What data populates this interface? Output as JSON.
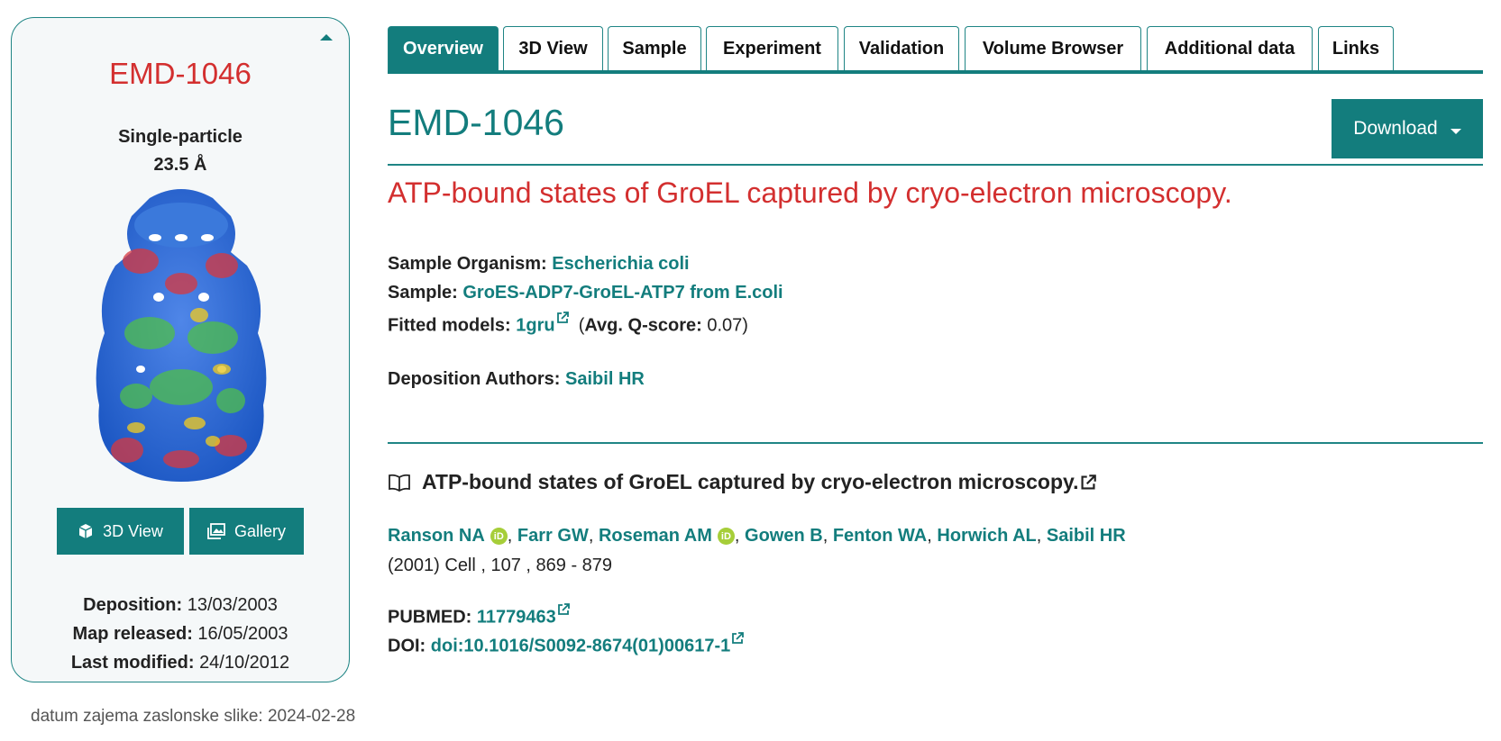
{
  "card": {
    "entry_id": "EMD-1046",
    "method": "Single-particle",
    "resolution": "23.5 Å",
    "buttons": {
      "view3d": "3D View",
      "gallery": "Gallery"
    },
    "deposition_label": "Deposition:",
    "deposition_value": "13/03/2003",
    "released_label": "Map released:",
    "released_value": "16/05/2003",
    "modified_label": "Last modified:",
    "modified_value": "24/10/2012"
  },
  "tabs": [
    {
      "label": "Overview",
      "active": true
    },
    {
      "label": "3D View"
    },
    {
      "label": "Sample"
    },
    {
      "label": "Experiment"
    },
    {
      "label": "Validation"
    },
    {
      "label": "Volume Browser"
    },
    {
      "label": "Additional data"
    },
    {
      "label": "Links"
    }
  ],
  "header": {
    "entry_id": "EMD-1046",
    "download_label": "Download"
  },
  "entry_title": "ATP-bound states of GroEL captured by cryo-electron microscopy.",
  "info": {
    "organism_label": "Sample Organism:",
    "organism_value": "Escherichia coli",
    "sample_label": "Sample:",
    "sample_value": "GroES-ADP7-GroEL-ATP7 from E.coli",
    "fitted_label": "Fitted models:",
    "fitted_value": "1gru",
    "qscore_label": "Avg. Q-score:",
    "qscore_value": "0.07",
    "authors_label": "Deposition Authors:",
    "authors_value": "Saibil HR"
  },
  "publication": {
    "title": "ATP-bound states of GroEL captured by cryo-electron microscopy.",
    "authors": [
      "Ranson NA",
      "Farr GW",
      "Roseman AM",
      "Gowen B",
      "Fenton WA",
      "Horwich AL",
      "Saibil HR"
    ],
    "citation": "(2001) Cell , 107 , 869 - 879",
    "pubmed_label": "PUBMED:",
    "pubmed_value": "11779463",
    "doi_label": "DOI:",
    "doi_value": "doi:10.1016/S0092-8674(01)00617-1"
  },
  "footer_note": "datum zajema zaslonske slike: 2024-02-28",
  "colors": {
    "teal": "#137d7d",
    "title_red": "#d32f2f",
    "orcid_green": "#a6ce39"
  }
}
